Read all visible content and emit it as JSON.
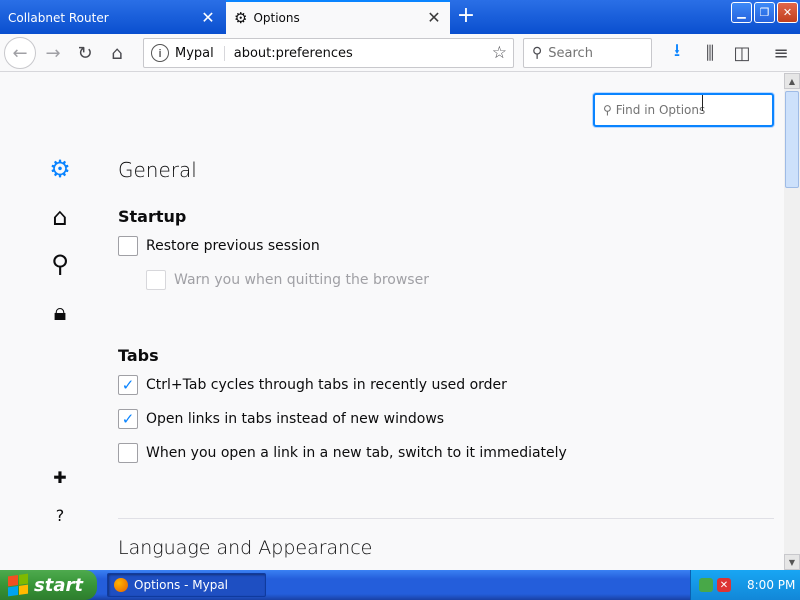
{
  "tabs": [
    {
      "title": "Collabnet Router",
      "active": false
    },
    {
      "title": "Options",
      "active": true
    }
  ],
  "navbar": {
    "site_label": "Mypal",
    "url": "about:preferences",
    "search_placeholder": "Search"
  },
  "find": {
    "placeholder": "Find in Options"
  },
  "categories": [
    "general",
    "home",
    "search",
    "privacy",
    "add-ons",
    "help"
  ],
  "page": {
    "title": "General",
    "startup_heading": "Startup",
    "tabs_heading": "Tabs",
    "next_section_heading": "Language and Appearance"
  },
  "options": {
    "restore": {
      "label": "Restore previous session",
      "checked": false,
      "disabled": false
    },
    "warn_quit": {
      "label": "Warn you when quitting the browser",
      "checked": false,
      "disabled": true
    },
    "ctrl_tab": {
      "label": "Ctrl+Tab cycles through tabs in recently used order",
      "checked": true,
      "disabled": false
    },
    "open_links": {
      "label": "Open links in tabs instead of new windows",
      "checked": true,
      "disabled": false
    },
    "switch_tab": {
      "label": "When you open a link in a new tab, switch to it immediately",
      "checked": false,
      "disabled": false
    }
  },
  "taskbar": {
    "start_label": "start",
    "task_label": "Options - Mypal",
    "clock": "8:00 PM"
  },
  "colors": {
    "accent": "#0a84ff",
    "titlebar": "#0a4fcf",
    "taskbar": "#245edb",
    "start": "#379537"
  },
  "icons": {
    "tab_options": "gear-icon",
    "new_tab": "plus-icon",
    "back": "arrow-left-icon",
    "forward": "arrow-right-icon",
    "reload": "reload-icon",
    "home": "home-icon",
    "site_info": "info-icon",
    "bookmark": "star-icon",
    "search": "search-icon",
    "download": "download-icon",
    "library": "library-icon",
    "sidebar": "sidebar-icon",
    "menu": "hamburger-icon"
  }
}
